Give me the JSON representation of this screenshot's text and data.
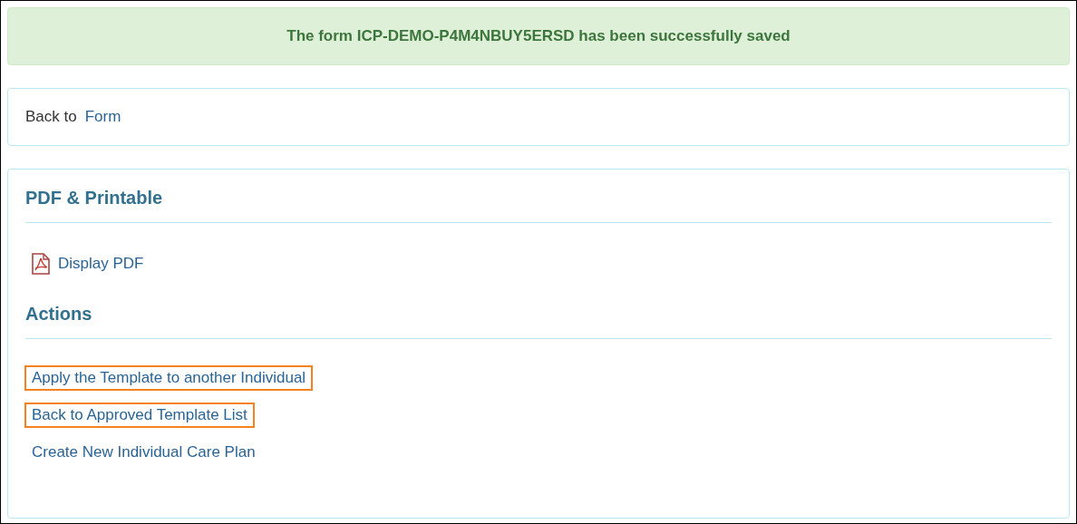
{
  "alert": {
    "message": "The form ICP-DEMO-P4M4NBUY5ERSD has been successfully saved"
  },
  "back_panel": {
    "label": "Back to",
    "link": "Form"
  },
  "sections": [
    {
      "title": "PDF & Printable",
      "links": [
        {
          "kind": "pdf",
          "label": "Display PDF",
          "highlighted": false
        }
      ]
    },
    {
      "title": "Actions",
      "links": [
        {
          "kind": "plain",
          "label": "Apply the Template to another Individual",
          "highlighted": true
        },
        {
          "kind": "plain",
          "label": "Back to Approved Template List",
          "highlighted": true
        },
        {
          "kind": "plain",
          "label": "Create New Individual Care Plan",
          "highlighted": false
        }
      ]
    }
  ]
}
